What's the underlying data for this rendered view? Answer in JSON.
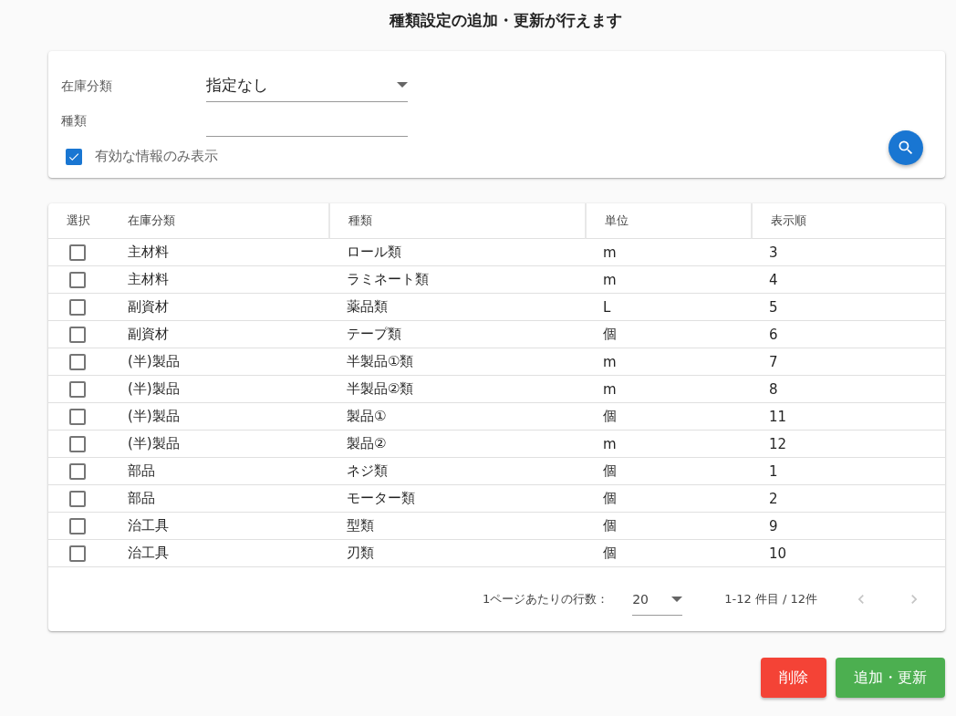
{
  "title": "種類設定の追加・更新が行えます",
  "filter": {
    "category_label": "在庫分類",
    "category_value": "指定なし",
    "type_label": "種類",
    "active_only": {
      "label": "有効な情報のみ表示",
      "checked": true
    }
  },
  "table": {
    "select_column": "選択",
    "columns": [
      "在庫分類",
      "種類",
      "単位",
      "表示順"
    ],
    "rows": [
      {
        "checked": false,
        "cells": [
          "主材料",
          "ロール類",
          "m",
          "3"
        ]
      },
      {
        "checked": false,
        "cells": [
          "主材料",
          "ラミネート類",
          "m",
          "4"
        ]
      },
      {
        "checked": false,
        "cells": [
          "副資材",
          "薬品類",
          "L",
          "5"
        ]
      },
      {
        "checked": false,
        "cells": [
          "副資材",
          "テープ類",
          "個",
          "6"
        ]
      },
      {
        "checked": false,
        "cells": [
          "(半)製品",
          "半製品①類",
          "m",
          "7"
        ]
      },
      {
        "checked": false,
        "cells": [
          "(半)製品",
          "半製品②類",
          "m",
          "8"
        ]
      },
      {
        "checked": false,
        "cells": [
          "(半)製品",
          "製品①",
          "個",
          "11"
        ]
      },
      {
        "checked": false,
        "cells": [
          "(半)製品",
          "製品②",
          "m",
          "12"
        ]
      },
      {
        "checked": false,
        "cells": [
          "部品",
          "ネジ類",
          "個",
          "1"
        ]
      },
      {
        "checked": false,
        "cells": [
          "部品",
          "モーター類",
          "個",
          "2"
        ]
      },
      {
        "checked": false,
        "cells": [
          "治工具",
          "型類",
          "個",
          "9"
        ]
      },
      {
        "checked": false,
        "cells": [
          "治工具",
          "刃類",
          "個",
          "10"
        ]
      }
    ],
    "pagination": {
      "rows_per_page_label": "1ページあたりの行数：",
      "rows_per_page": "20",
      "range": "1-12 件目 / 12件",
      "prev_disabled": true,
      "next_disabled": true
    }
  },
  "buttons": [
    {
      "label": "削除",
      "kind": "danger"
    },
    {
      "label": "追加・更新",
      "kind": "primary"
    }
  ]
}
